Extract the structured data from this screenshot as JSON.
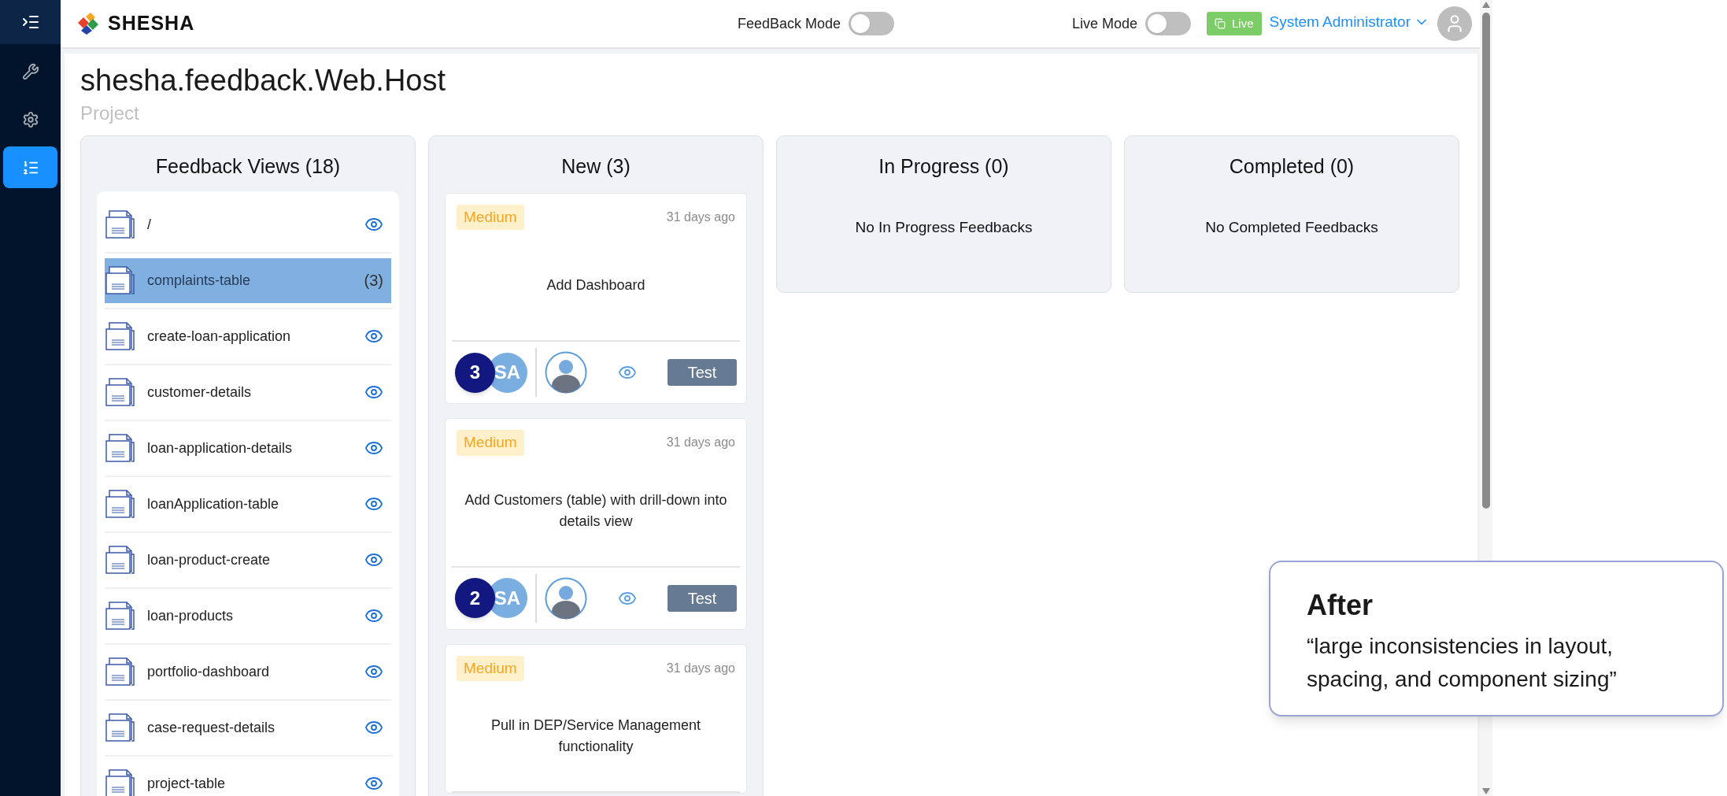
{
  "sidebar": {
    "items": [
      {
        "selected": false
      },
      {
        "selected": false
      },
      {
        "selected": true
      }
    ]
  },
  "header": {
    "logo": "SHESHA",
    "feedback_mode": {
      "label": "FeedBack Mode",
      "on": false
    },
    "live_mode": {
      "label": "Live Mode",
      "on": false
    },
    "live_tag": "Live",
    "user": "System Administrator"
  },
  "page": {
    "title": "shesha.feedback.Web.Host",
    "subtitle": "Project"
  },
  "views": {
    "title": "Feedback Views (18)",
    "items": [
      {
        "name": "/",
        "selected": false
      },
      {
        "name": "complaints-table",
        "count": "(3)",
        "selected": true
      },
      {
        "name": "create-loan-application",
        "selected": false
      },
      {
        "name": "customer-details",
        "selected": false
      },
      {
        "name": "loan-application-details",
        "selected": false
      },
      {
        "name": "loanApplication-table",
        "selected": false
      },
      {
        "name": "loan-product-create",
        "selected": false
      },
      {
        "name": "loan-products",
        "selected": false
      },
      {
        "name": "portfolio-dashboard",
        "selected": false
      },
      {
        "name": "case-request-details",
        "selected": false
      },
      {
        "name": "project-table",
        "selected": false
      }
    ]
  },
  "columns": [
    {
      "title": "New (3)",
      "cards": [
        {
          "priority": "Medium",
          "time": "31 days ago",
          "text": "Add Dashboard",
          "count": "3",
          "initials": "SA",
          "button": "Test"
        },
        {
          "priority": "Medium",
          "time": "31 days ago",
          "text": "Add Customers (table) with drill-down into details view",
          "count": "2",
          "initials": "SA",
          "button": "Test"
        },
        {
          "priority": "Medium",
          "time": "31 days ago",
          "text": "Pull in DEP/Service Management functionality"
        }
      ]
    },
    {
      "title": "In Progress (0)",
      "empty": "No In Progress Feedbacks"
    },
    {
      "title": "Completed (0)",
      "empty": "No Completed Feedbacks"
    }
  ],
  "callout": {
    "title": "After",
    "quote": "“large inconsistencies in layout, spacing, and component sizing”"
  }
}
